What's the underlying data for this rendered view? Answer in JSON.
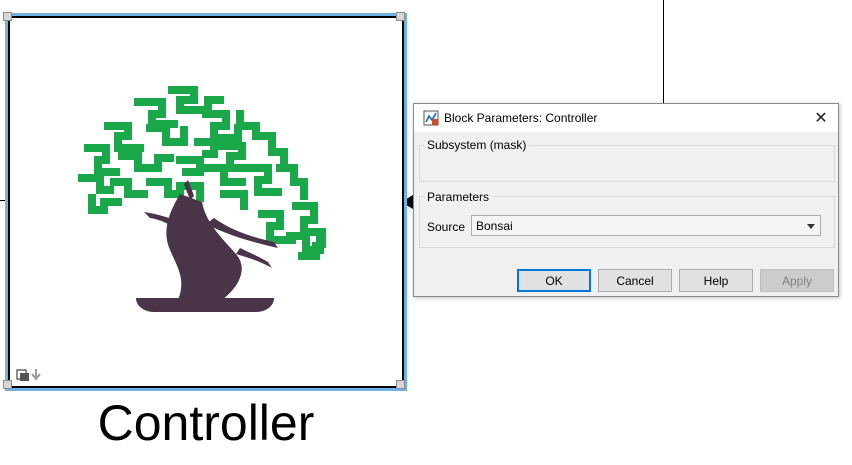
{
  "block": {
    "label": "Controller",
    "icon": "bonsai-tree-icon"
  },
  "dialog": {
    "title": "Block Parameters: Controller",
    "close_icon": "✕",
    "mask_group_title": "Subsystem (mask)",
    "parameters_group_title": "Parameters",
    "source_label": "Source",
    "source_value": "Bonsai",
    "buttons": {
      "ok": "OK",
      "cancel": "Cancel",
      "help": "Help",
      "apply": "Apply"
    }
  },
  "colors": {
    "selection": "#6fb3e6",
    "bonsai_leaves": "#1aa84a",
    "bonsai_trunk": "#4a3548",
    "ok_focus": "#0078d7"
  }
}
